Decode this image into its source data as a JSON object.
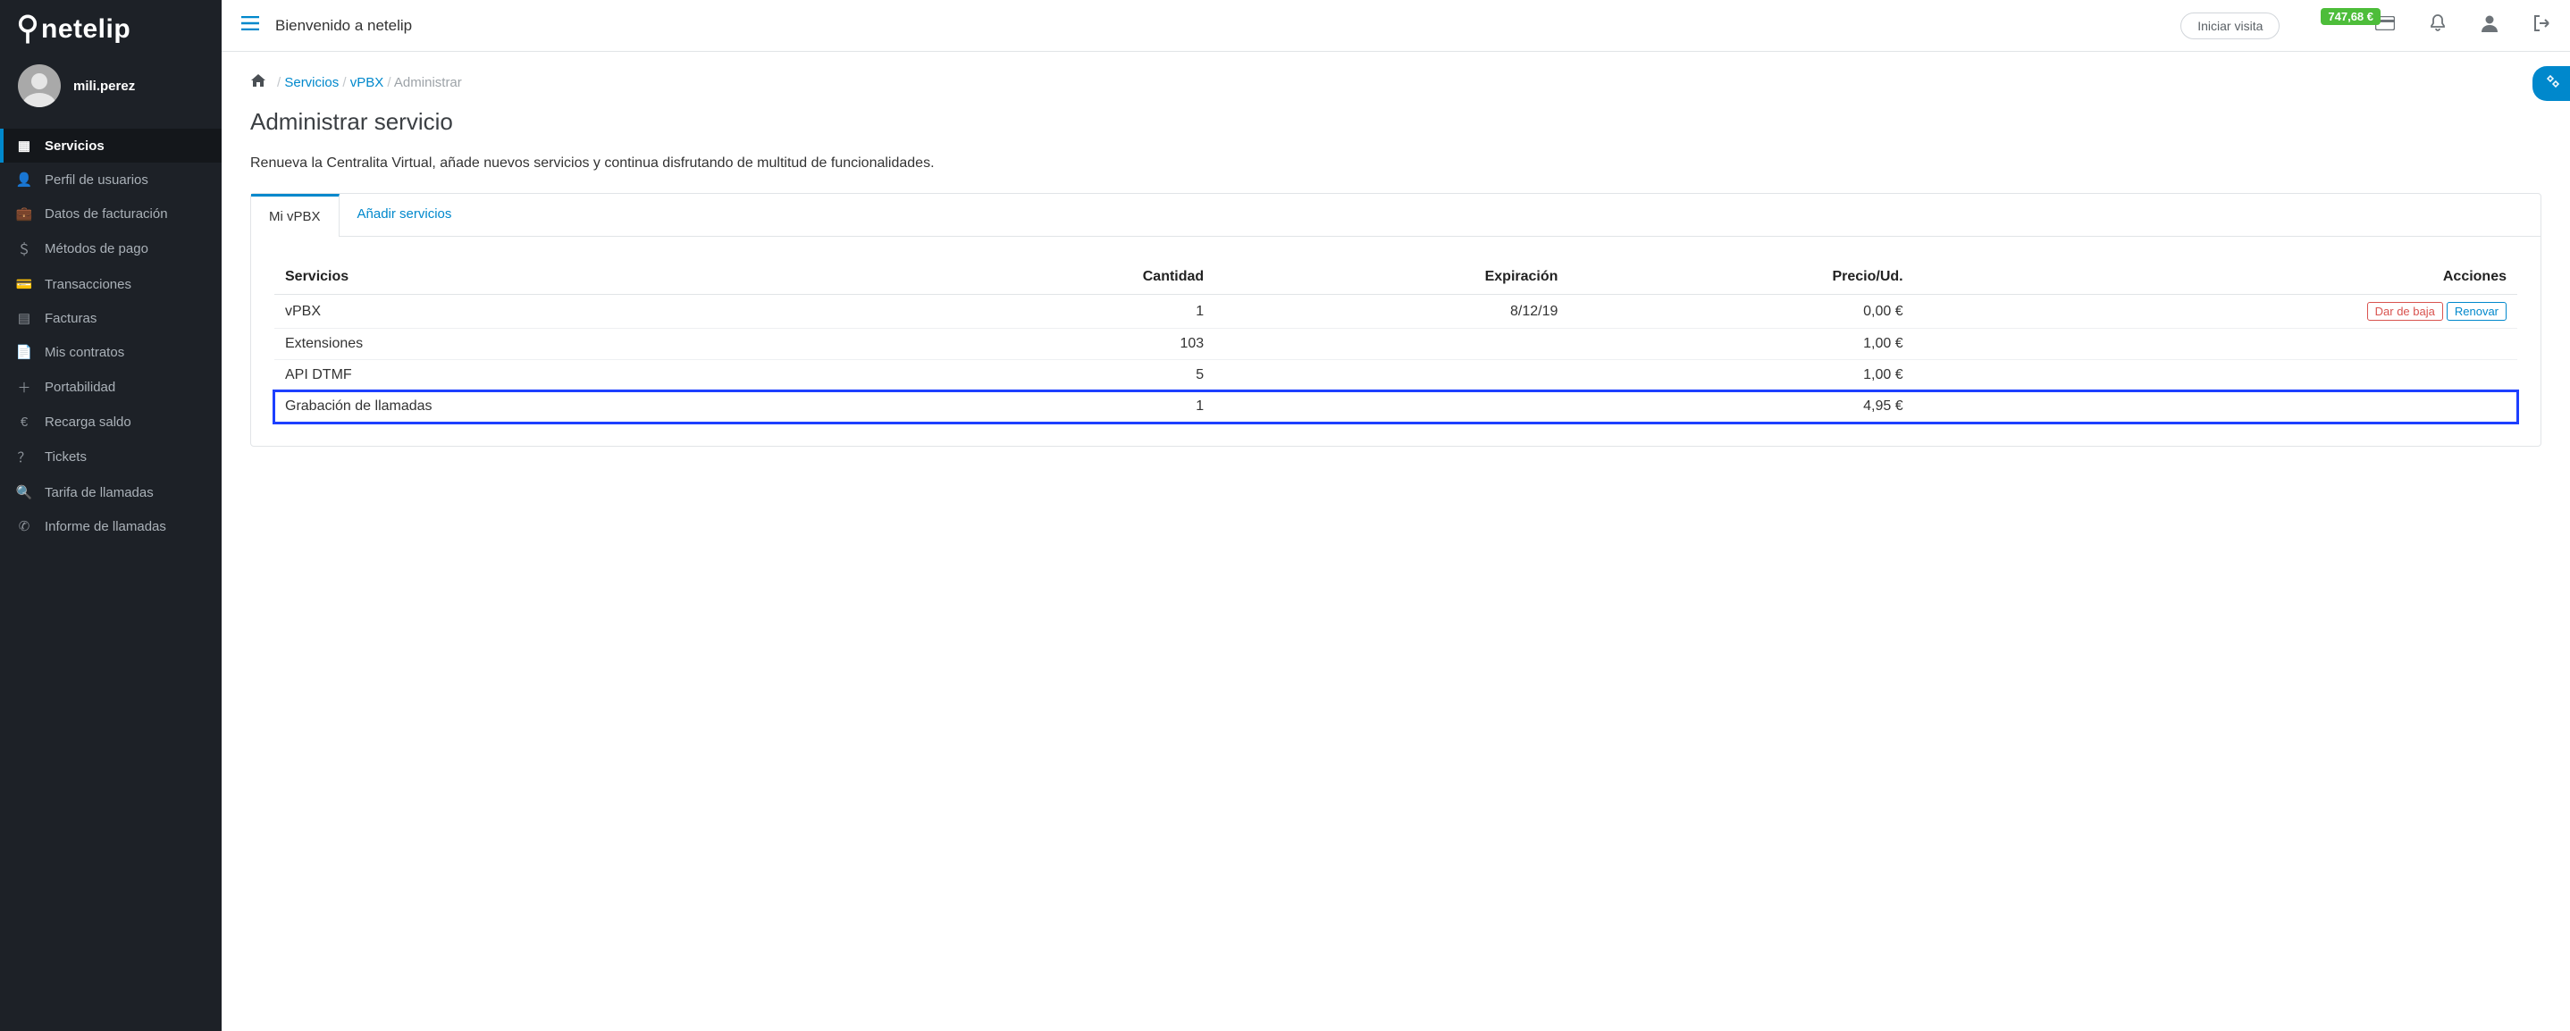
{
  "brand": "netelip",
  "user": {
    "name": "mili.perez"
  },
  "topbar": {
    "welcome": "Bienvenido a netelip",
    "start_visit": "Iniciar visita",
    "balance": "747,68 €"
  },
  "sidebar": {
    "items": [
      {
        "label": "Servicios",
        "icon": "grid-icon",
        "active": true
      },
      {
        "label": "Perfil de usuarios",
        "icon": "user-icon",
        "active": false
      },
      {
        "label": "Datos de facturación",
        "icon": "briefcase-icon",
        "active": false
      },
      {
        "label": "Métodos de pago",
        "icon": "dollar-icon",
        "active": false
      },
      {
        "label": "Transacciones",
        "icon": "card-icon",
        "active": false
      },
      {
        "label": "Facturas",
        "icon": "document-icon",
        "active": false
      },
      {
        "label": "Mis contratos",
        "icon": "file-icon",
        "active": false
      },
      {
        "label": "Portabilidad",
        "icon": "plus-icon",
        "active": false
      },
      {
        "label": "Recarga saldo",
        "icon": "euro-icon",
        "active": false
      },
      {
        "label": "Tickets",
        "icon": "help-icon",
        "active": false
      },
      {
        "label": "Tarifa de llamadas",
        "icon": "search-icon",
        "active": false
      },
      {
        "label": "Informe de llamadas",
        "icon": "phone-icon",
        "active": false
      }
    ]
  },
  "breadcrumb": {
    "items": [
      {
        "label": "Servicios",
        "link": true
      },
      {
        "label": "vPBX",
        "link": true
      },
      {
        "label": "Administrar",
        "link": false
      }
    ]
  },
  "page": {
    "title": "Administrar servicio",
    "description": "Renueva la Centralita Virtual, añade nuevos servicios y continua disfrutando de multitud de funcionalidades."
  },
  "tabs": [
    {
      "label": "Mi vPBX",
      "active": true
    },
    {
      "label": "Añadir servicios",
      "active": false
    }
  ],
  "table": {
    "headers": {
      "service": "Servicios",
      "qty": "Cantidad",
      "exp": "Expiración",
      "price": "Precio/Ud.",
      "actions": "Acciones"
    },
    "actions": {
      "cancel": "Dar de baja",
      "renew": "Renovar"
    },
    "rows": [
      {
        "service": "vPBX",
        "qty": "1",
        "exp": "8/12/19",
        "price": "0,00 €",
        "has_actions": true,
        "highlight": false
      },
      {
        "service": "Extensiones",
        "qty": "103",
        "exp": "",
        "price": "1,00 €",
        "has_actions": false,
        "highlight": false
      },
      {
        "service": "API DTMF",
        "qty": "5",
        "exp": "",
        "price": "1,00 €",
        "has_actions": false,
        "highlight": false
      },
      {
        "service": "Grabación de llamadas",
        "qty": "1",
        "exp": "",
        "price": "4,95 €",
        "has_actions": false,
        "highlight": true
      }
    ]
  }
}
